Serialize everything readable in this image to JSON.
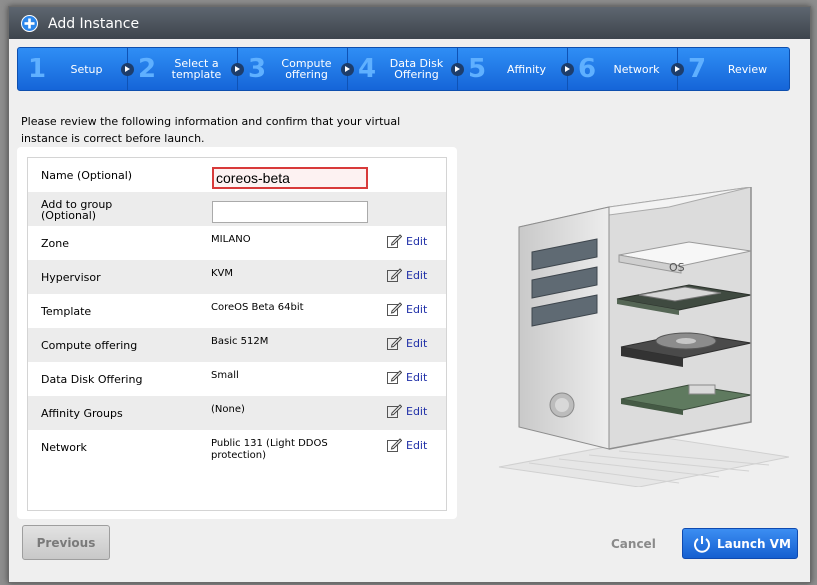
{
  "dialog": {
    "title": "Add Instance",
    "icon": "plus-circle-icon"
  },
  "steps": [
    {
      "number": "1",
      "label": "Setup"
    },
    {
      "number": "2",
      "label": "Select a\ntemplate"
    },
    {
      "number": "3",
      "label": "Compute\noffering"
    },
    {
      "number": "4",
      "label": "Data Disk\nOffering"
    },
    {
      "number": "5",
      "label": "Affinity"
    },
    {
      "number": "6",
      "label": "Network"
    },
    {
      "number": "7",
      "label": "Review"
    }
  ],
  "intro": "Please review the following information and confirm that your virtual instance is correct before launch.",
  "fields": {
    "name": {
      "label": "Name (Optional)",
      "value": "coreos-beta"
    },
    "group": {
      "label": "Add to group (Optional)",
      "value": ""
    }
  },
  "rows": [
    {
      "label": "Zone",
      "value": "MILANO",
      "edit": "Edit"
    },
    {
      "label": "Hypervisor",
      "value": "KVM",
      "edit": "Edit"
    },
    {
      "label": "Template",
      "value": "CoreOS Beta 64bit",
      "edit": "Edit"
    },
    {
      "label": "Compute offering",
      "value": "Basic 512M",
      "edit": "Edit"
    },
    {
      "label": "Data Disk Offering",
      "value": "Small",
      "edit": "Edit"
    },
    {
      "label": "Affinity Groups",
      "value": "(None)",
      "edit": "Edit"
    },
    {
      "label": "Network",
      "value": "Public 131 (Light DDOS protection)",
      "edit": "Edit"
    }
  ],
  "illustration": {
    "os_label": "OS",
    "icon": "server-tower-illustration"
  },
  "buttons": {
    "previous": "Previous",
    "cancel": "Cancel",
    "launch": "Launch VM"
  },
  "colors": {
    "accent": "#1f74e6",
    "error_border": "#d83a3a",
    "link": "#2030a8"
  }
}
